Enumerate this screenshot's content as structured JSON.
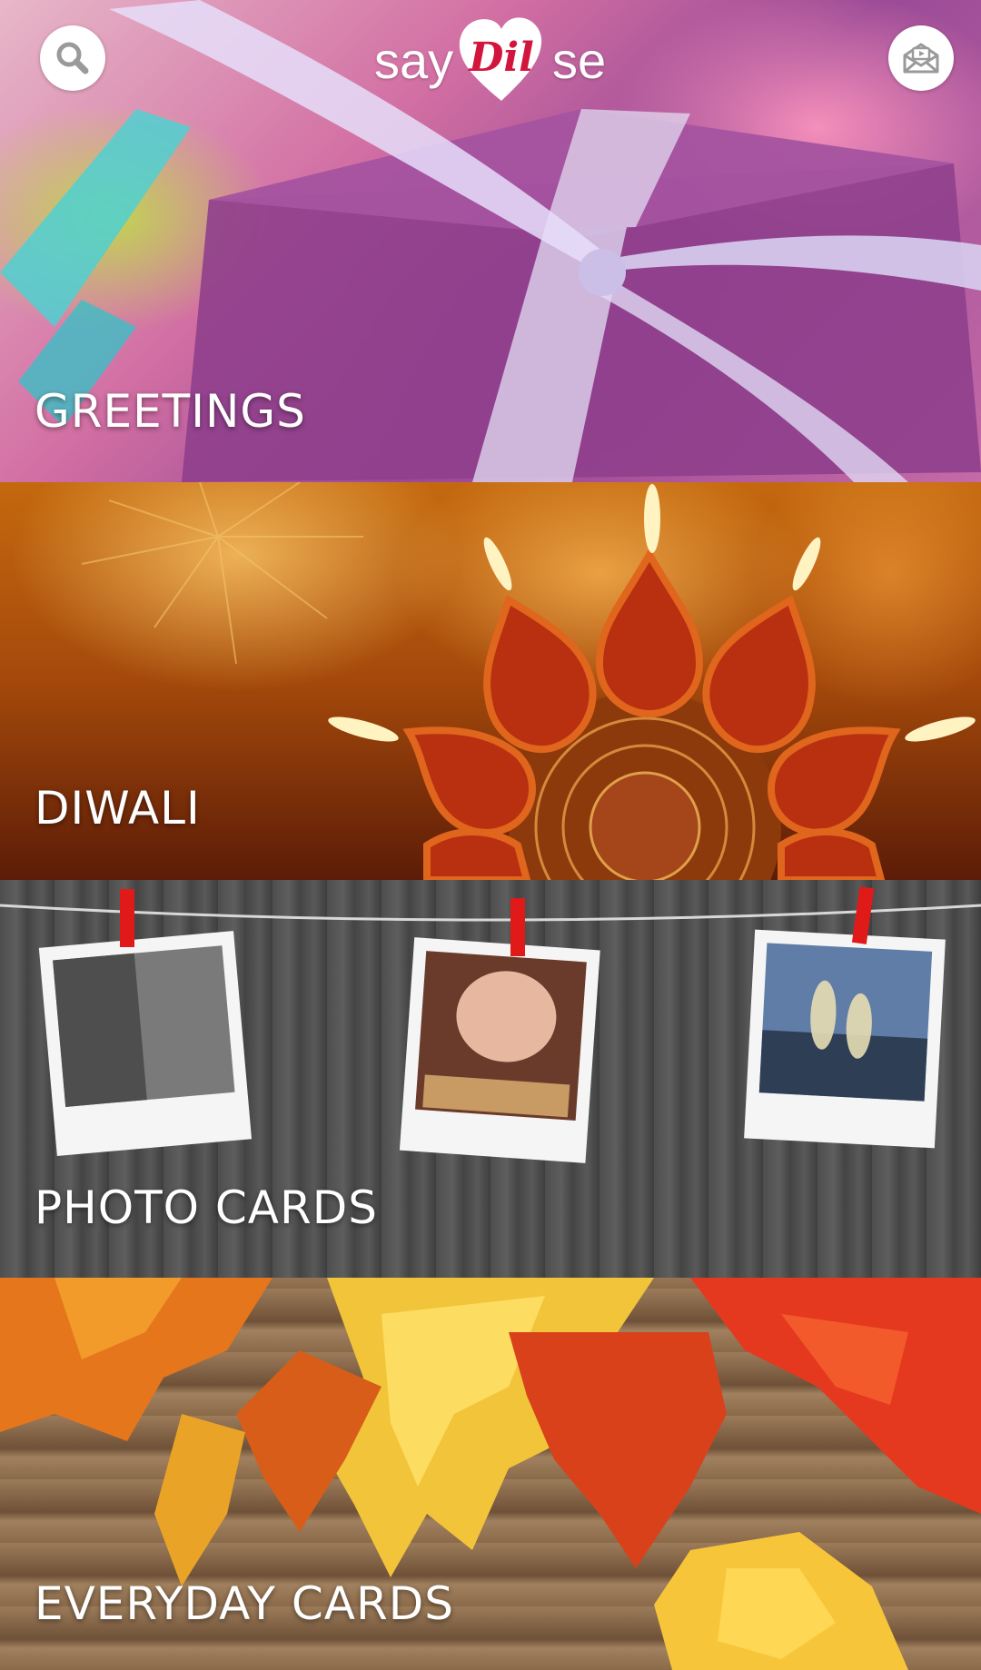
{
  "header": {
    "logo": {
      "word_left": "say",
      "word_heart": "Dil",
      "word_right": "se"
    },
    "search_icon": "search-icon",
    "inbox_icon": "envelope-video-icon"
  },
  "panels": [
    {
      "label": "GREETINGS"
    },
    {
      "label": "DIWALI"
    },
    {
      "label": "PHOTO CARDS"
    },
    {
      "label": "EVERYDAY CARDS"
    }
  ],
  "colors": {
    "logo_heart": "#d3143c",
    "label": "#ffffff"
  }
}
